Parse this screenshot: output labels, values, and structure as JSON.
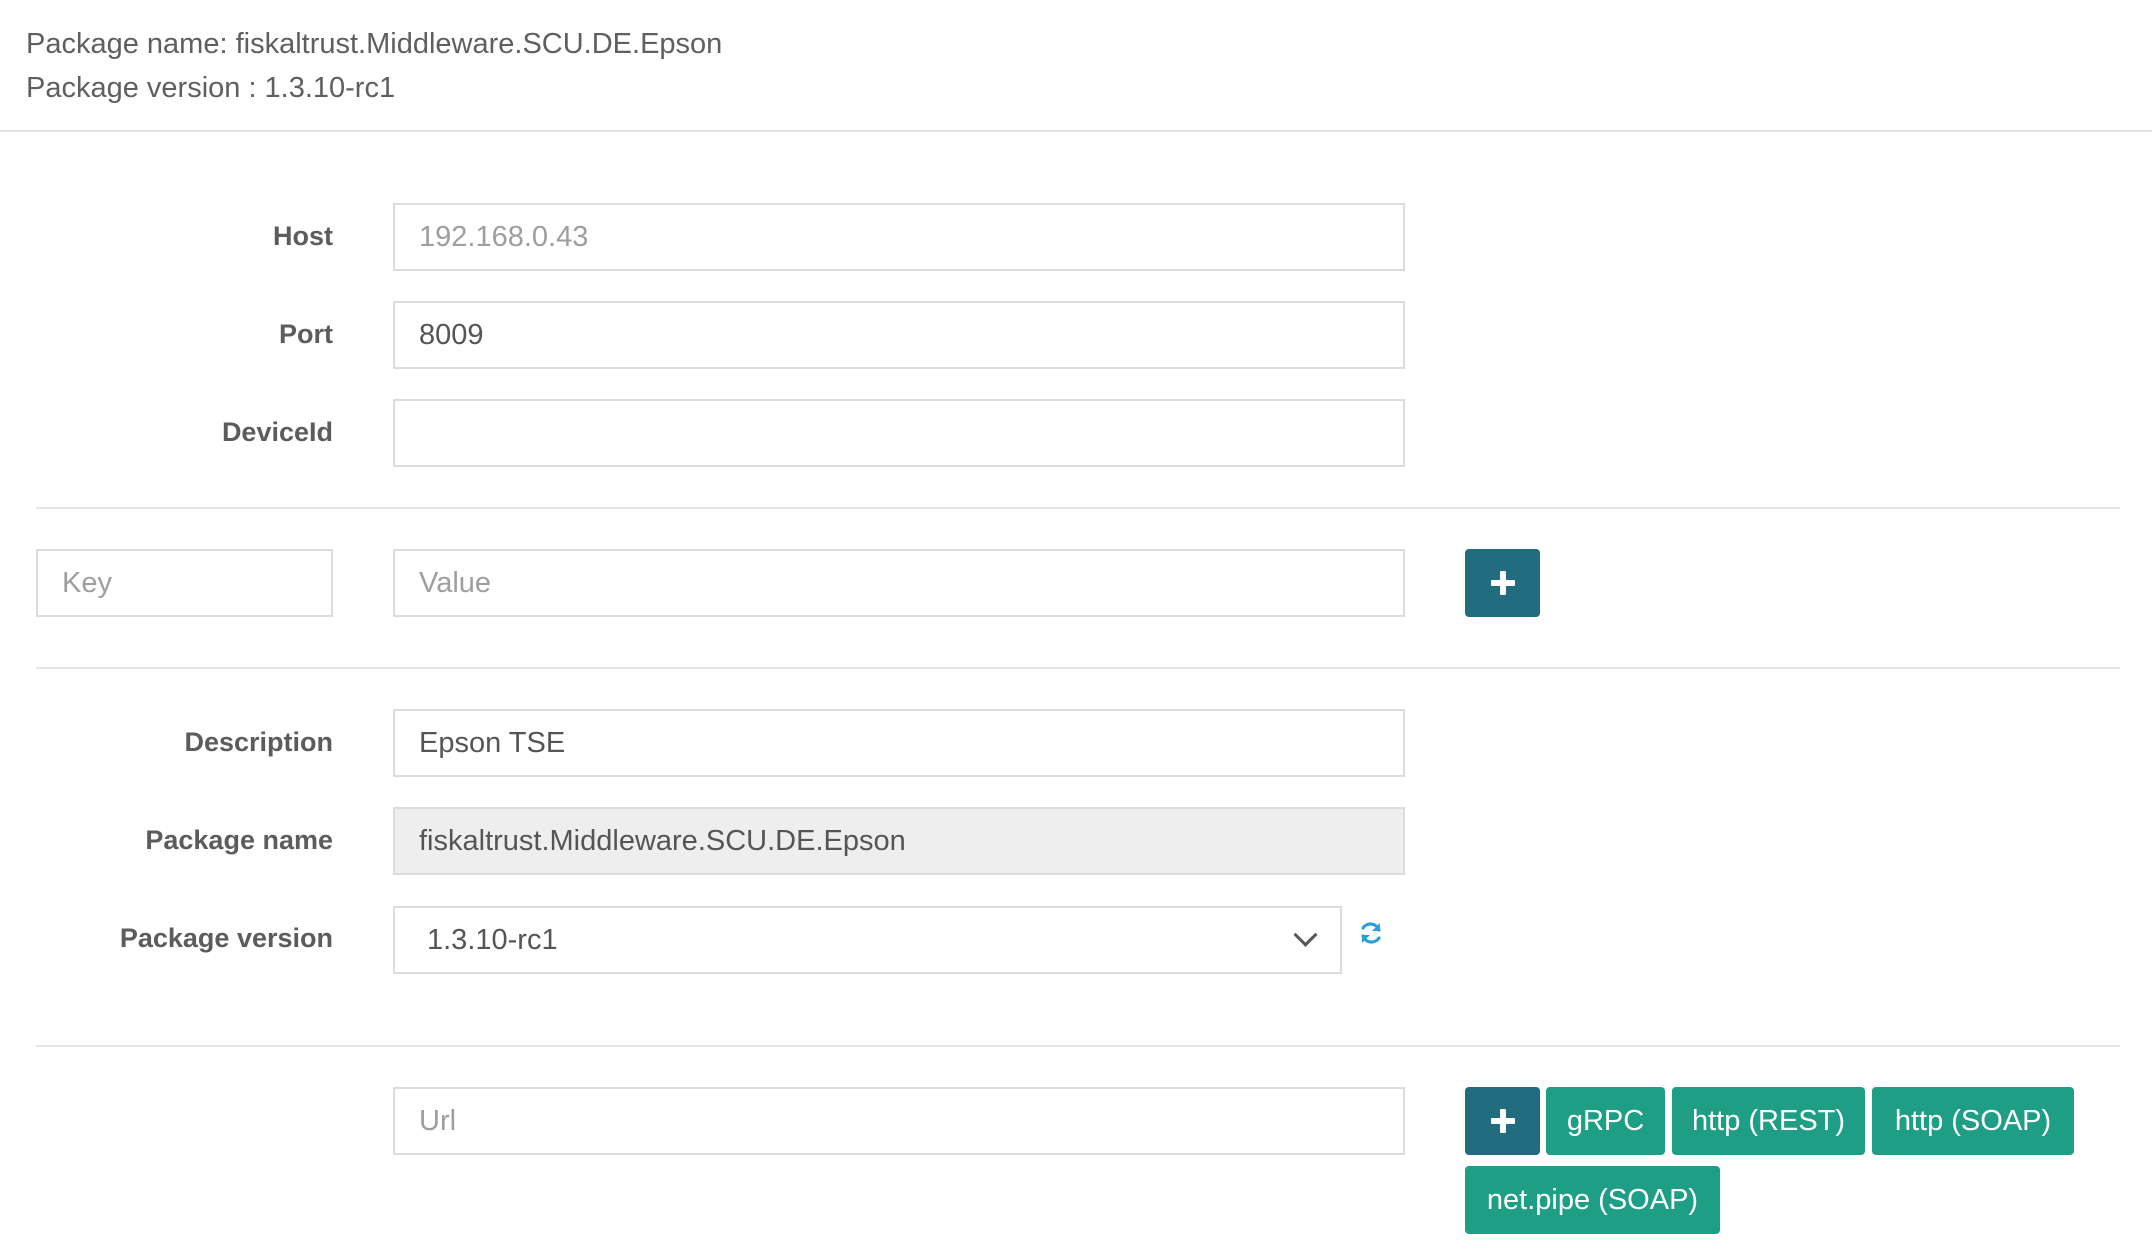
{
  "header": {
    "package_name_label": "Package name:",
    "package_name_value": "fiskaltrust.Middleware.SCU.DE.Epson",
    "package_version_label": "Package version :",
    "package_version_value": "1.3.10-rc1"
  },
  "config": {
    "host_label": "Host",
    "host_placeholder": "192.168.0.43",
    "port_label": "Port",
    "port_value": "8009",
    "device_id_label": "DeviceId",
    "device_id_value": ""
  },
  "custom_param": {
    "key_placeholder": "Key",
    "value_placeholder": "Value"
  },
  "package": {
    "description_label": "Description",
    "description_value": "Epson TSE",
    "package_name_label": "Package name",
    "package_name_value": "fiskaltrust.Middleware.SCU.DE.Epson",
    "package_version_label": "Package version",
    "package_version_selected": "1.3.10-rc1"
  },
  "urls": {
    "url_placeholder": "Url",
    "buttons": [
      "gRPC",
      "http (REST)",
      "http (SOAP)",
      "net.pipe (SOAP)"
    ]
  },
  "icons": {
    "add": "plus-icon",
    "refresh": "refresh-icon",
    "dropdown": "chevron-down-icon"
  },
  "colors": {
    "primary_dark": "#226c80",
    "teal": "#1f9e86",
    "refresh_blue": "#2aa0d6"
  }
}
